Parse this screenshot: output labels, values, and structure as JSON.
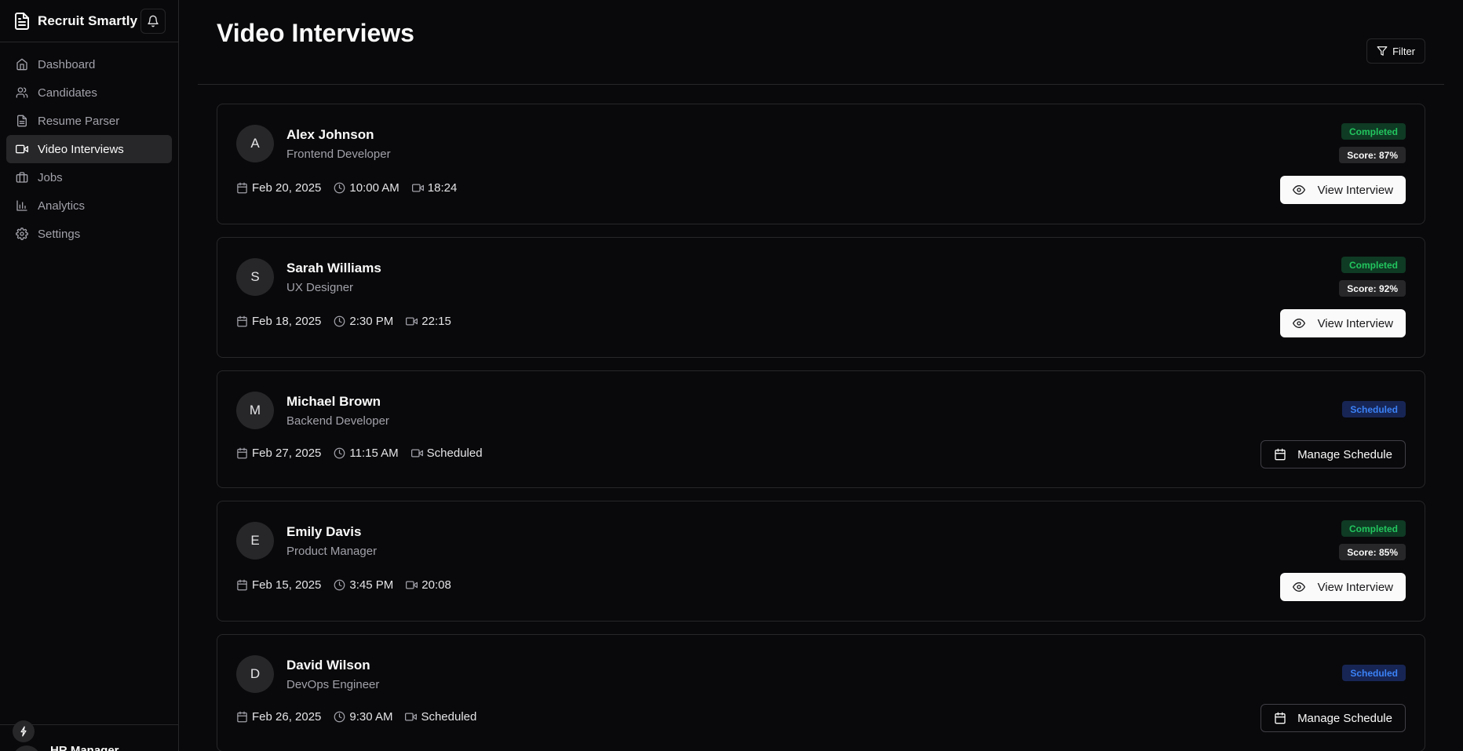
{
  "app": {
    "name": "Recruit Smartly"
  },
  "sidebar": {
    "items": [
      {
        "label": "Dashboard",
        "icon": "home-icon"
      },
      {
        "label": "Candidates",
        "icon": "users-icon"
      },
      {
        "label": "Resume Parser",
        "icon": "file-text-icon"
      },
      {
        "label": "Video Interviews",
        "icon": "video-icon",
        "active": true
      },
      {
        "label": "Jobs",
        "icon": "briefcase-icon"
      },
      {
        "label": "Analytics",
        "icon": "bar-chart-icon"
      },
      {
        "label": "Settings",
        "icon": "gear-icon"
      }
    ],
    "user_name": "HR Manager"
  },
  "page": {
    "title": "Video Interviews",
    "filter_label": "Filter"
  },
  "interviews": [
    {
      "initial": "A",
      "name": "Alex Johnson",
      "role": "Frontend Developer",
      "date": "Feb 20, 2025",
      "time": "10:00 AM",
      "duration": "18:24",
      "status": "Completed",
      "score": "Score: 87%",
      "action": "View Interview"
    },
    {
      "initial": "S",
      "name": "Sarah Williams",
      "role": "UX Designer",
      "date": "Feb 18, 2025",
      "time": "2:30 PM",
      "duration": "22:15",
      "status": "Completed",
      "score": "Score: 92%",
      "action": "View Interview"
    },
    {
      "initial": "M",
      "name": "Michael Brown",
      "role": "Backend Developer",
      "date": "Feb 27, 2025",
      "time": "11:15 AM",
      "duration": "Scheduled",
      "status": "Scheduled",
      "action": "Manage Schedule"
    },
    {
      "initial": "E",
      "name": "Emily Davis",
      "role": "Product Manager",
      "date": "Feb 15, 2025",
      "time": "3:45 PM",
      "duration": "20:08",
      "status": "Completed",
      "score": "Score: 85%",
      "action": "View Interview"
    },
    {
      "initial": "D",
      "name": "David Wilson",
      "role": "DevOps Engineer",
      "date": "Feb 26, 2025",
      "time": "9:30 AM",
      "duration": "Scheduled",
      "status": "Scheduled",
      "action": "Manage Schedule"
    }
  ],
  "colors": {
    "background": "#09090b",
    "completed": "#22c55e",
    "scheduled": "#3b82f6",
    "border": "#27272a"
  }
}
